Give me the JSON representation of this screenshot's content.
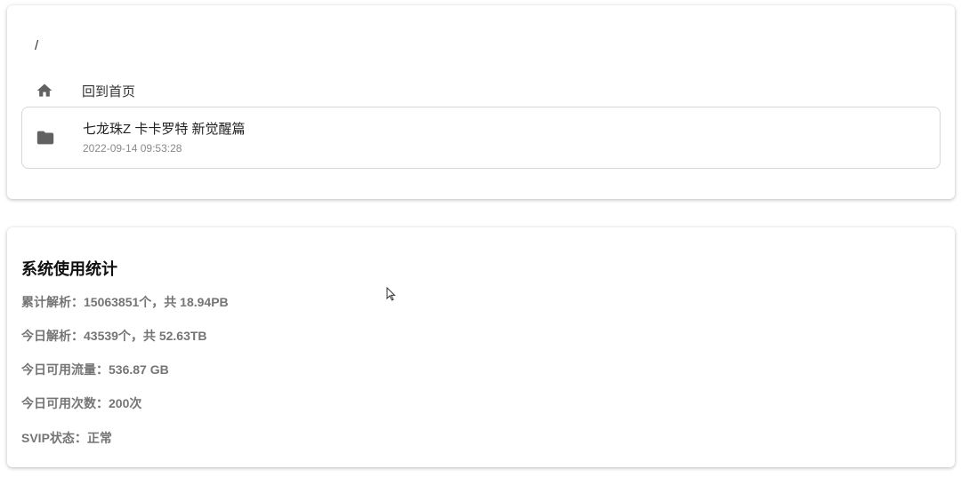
{
  "breadcrumb": {
    "path": "/"
  },
  "nav": {
    "home_label": "回到首页",
    "home_icon": "home-icon"
  },
  "folder": {
    "icon": "folder-icon",
    "name": "七龙珠Z 卡卡罗特 新觉醒篇",
    "date": "2022-09-14 09:53:28"
  },
  "stats": {
    "title": "系统使用统计",
    "lines": [
      "累计解析：15063851个，共 18.94PB",
      "今日解析：43539个，共 52.63TB",
      "今日可用流量：536.87 GB",
      "今日可用次数：200次",
      "SVIP状态：正常"
    ]
  },
  "colors": {
    "icon": "#616161",
    "muted": "#757575",
    "border": "#d7d7d7"
  }
}
